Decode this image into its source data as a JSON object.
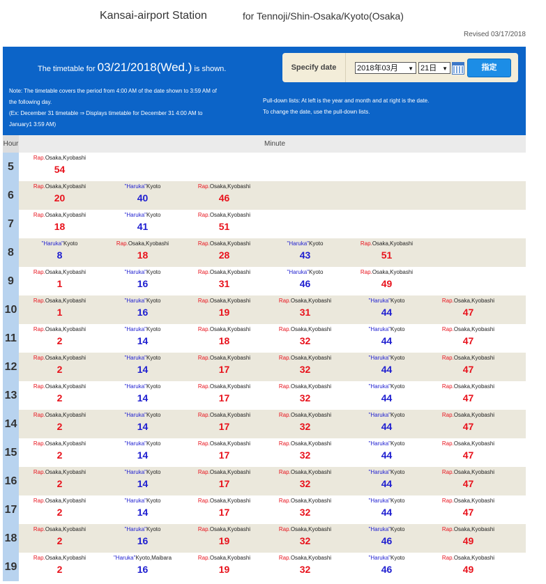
{
  "station": "Kansai-airport Station",
  "direction": "for Tennoji/Shin-Osaka/Kyoto(Osaka)",
  "revised": "Revised 03/17/2018",
  "banner": {
    "shown_prefix": "The timetable for",
    "shown_date": "03/21/2018(Wed.)",
    "shown_suffix": "is shown.",
    "note_left": [
      "Note: The timetable covers the period from 4:00 AM of the date shown to 3:59 AM of",
      "the following day.",
      "(Ex: December 31 timetable ⇒ Displays timetable for December 31 4:00 AM to",
      "January1 3:59 AM)"
    ],
    "note_right": [
      "Pull-down lists: At left is the year and month and at right is the date.",
      "To change the date, use the pull-down lists."
    ],
    "specify_label": "Specify date",
    "ym_value": "2018年03月",
    "day_value": "21日",
    "submit_label": "指定"
  },
  "header": {
    "hour": "Hour",
    "minute": "Minute"
  },
  "colors": {
    "banner": "#0c64c8",
    "rapid": "#e8121c",
    "haruka": "#1d1dd0"
  },
  "rows": [
    {
      "hour": "5",
      "cells": [
        {
          "t": "r",
          "m": "54"
        }
      ]
    },
    {
      "hour": "6",
      "cells": [
        {
          "t": "r",
          "m": "20"
        },
        {
          "t": "h",
          "m": "40"
        },
        {
          "t": "r",
          "m": "46"
        }
      ]
    },
    {
      "hour": "7",
      "cells": [
        {
          "t": "r",
          "m": "18"
        },
        {
          "t": "h",
          "m": "41"
        },
        {
          "t": "r",
          "m": "51"
        }
      ]
    },
    {
      "hour": "8",
      "cells": [
        {
          "t": "h",
          "m": "8"
        },
        {
          "t": "r",
          "m": "18"
        },
        {
          "t": "r",
          "m": "28"
        },
        {
          "t": "h",
          "m": "43"
        },
        {
          "t": "r",
          "m": "51"
        }
      ]
    },
    {
      "hour": "9",
      "cells": [
        {
          "t": "r",
          "m": "1"
        },
        {
          "t": "h",
          "m": "16"
        },
        {
          "t": "r",
          "m": "31"
        },
        {
          "t": "h",
          "m": "46"
        },
        {
          "t": "r",
          "m": "49"
        }
      ]
    },
    {
      "hour": "10",
      "cells": [
        {
          "t": "r",
          "m": "1"
        },
        {
          "t": "h",
          "m": "16"
        },
        {
          "t": "r",
          "m": "19"
        },
        {
          "t": "r",
          "m": "31"
        },
        {
          "t": "h",
          "m": "44"
        },
        {
          "t": "r",
          "m": "47"
        }
      ]
    },
    {
      "hour": "11",
      "cells": [
        {
          "t": "r",
          "m": "2"
        },
        {
          "t": "h",
          "m": "14"
        },
        {
          "t": "r",
          "m": "18"
        },
        {
          "t": "r",
          "m": "32"
        },
        {
          "t": "h",
          "m": "44"
        },
        {
          "t": "r",
          "m": "47"
        }
      ]
    },
    {
      "hour": "12",
      "cells": [
        {
          "t": "r",
          "m": "2"
        },
        {
          "t": "h",
          "m": "14"
        },
        {
          "t": "r",
          "m": "17"
        },
        {
          "t": "r",
          "m": "32"
        },
        {
          "t": "h",
          "m": "44"
        },
        {
          "t": "r",
          "m": "47"
        }
      ]
    },
    {
      "hour": "13",
      "cells": [
        {
          "t": "r",
          "m": "2"
        },
        {
          "t": "h",
          "m": "14"
        },
        {
          "t": "r",
          "m": "17"
        },
        {
          "t": "r",
          "m": "32"
        },
        {
          "t": "h",
          "m": "44"
        },
        {
          "t": "r",
          "m": "47"
        }
      ]
    },
    {
      "hour": "14",
      "cells": [
        {
          "t": "r",
          "m": "2"
        },
        {
          "t": "h",
          "m": "14"
        },
        {
          "t": "r",
          "m": "17"
        },
        {
          "t": "r",
          "m": "32"
        },
        {
          "t": "h",
          "m": "44"
        },
        {
          "t": "r",
          "m": "47"
        }
      ]
    },
    {
      "hour": "15",
      "cells": [
        {
          "t": "r",
          "m": "2"
        },
        {
          "t": "h",
          "m": "14"
        },
        {
          "t": "r",
          "m": "17"
        },
        {
          "t": "r",
          "m": "32"
        },
        {
          "t": "h",
          "m": "44"
        },
        {
          "t": "r",
          "m": "47"
        }
      ]
    },
    {
      "hour": "16",
      "cells": [
        {
          "t": "r",
          "m": "2"
        },
        {
          "t": "h",
          "m": "14"
        },
        {
          "t": "r",
          "m": "17"
        },
        {
          "t": "r",
          "m": "32"
        },
        {
          "t": "h",
          "m": "44"
        },
        {
          "t": "r",
          "m": "47"
        }
      ]
    },
    {
      "hour": "17",
      "cells": [
        {
          "t": "r",
          "m": "2"
        },
        {
          "t": "h",
          "m": "14"
        },
        {
          "t": "r",
          "m": "17"
        },
        {
          "t": "r",
          "m": "32"
        },
        {
          "t": "h",
          "m": "44"
        },
        {
          "t": "r",
          "m": "47"
        }
      ]
    },
    {
      "hour": "18",
      "cells": [
        {
          "t": "r",
          "m": "2"
        },
        {
          "t": "h",
          "m": "16"
        },
        {
          "t": "r",
          "m": "19"
        },
        {
          "t": "r",
          "m": "32"
        },
        {
          "t": "h",
          "m": "46"
        },
        {
          "t": "r",
          "m": "49"
        }
      ]
    },
    {
      "hour": "19",
      "cells": [
        {
          "t": "r",
          "m": "2"
        },
        {
          "t": "hm",
          "m": "16"
        },
        {
          "t": "r",
          "m": "19"
        },
        {
          "t": "r",
          "m": "32"
        },
        {
          "t": "h",
          "m": "46"
        },
        {
          "t": "r",
          "m": "49"
        }
      ]
    }
  ],
  "labels": {
    "rap_tag": "Rap.",
    "rap_dest": "Osaka,Kyobashi",
    "haruka_tag": "\"Haruka\"",
    "haruka_dest": "Kyoto",
    "haruka_dest_maibara": "Kyoto,Maibara"
  }
}
